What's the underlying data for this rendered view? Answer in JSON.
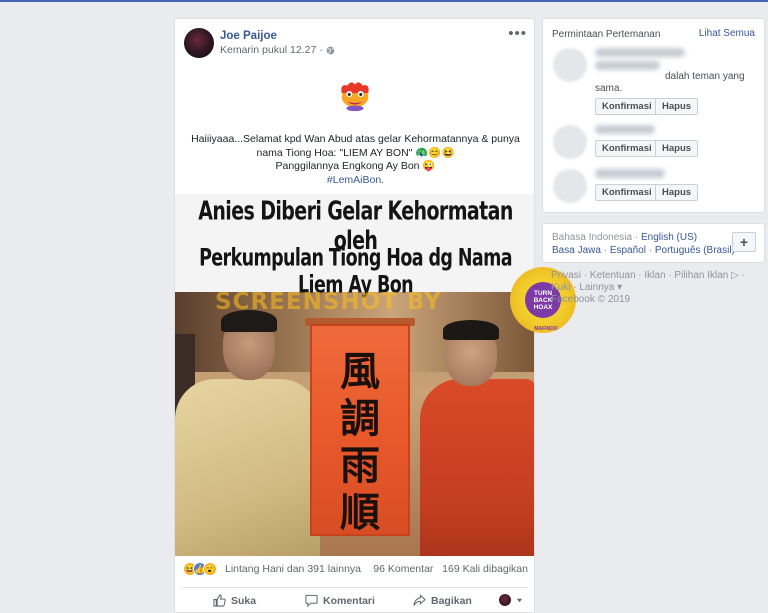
{
  "post": {
    "author": "Joe Paijoe",
    "timestamp": "Kemarin pukul 12.27",
    "privacy_separator": "·",
    "privacy_icon": "globe-icon",
    "more_label": "•••",
    "text_line1": "Haiiiyaaa...Selamat kpd Wan Abud atas gelar Kehormatannya & punya",
    "text_line2": "nama Tiong Hoa: \"LIEM AY BON\" 🦚😊😆",
    "text_line3": "Panggilannya Engkong Ay Bon 😜",
    "hashtag": "#LemAiBon.",
    "image": {
      "headline1": "Anies Diberi Gelar  Kehormatan oleh",
      "headline2": "Perkumpulan Tiong Hoa dg Nama Liem Ay Bon",
      "watermark": "SCREENSHOT BY",
      "scroll_chars": [
        "風",
        "調",
        "雨",
        "順"
      ],
      "seal_text": [
        "TURN",
        "BACK",
        "HOAX"
      ],
      "seal_ring": "MAFINDO"
    },
    "reactions_text": "Lintang Hani dan 391 lainnya",
    "comments_count": "96 Komentar",
    "shares_count": "169 Kali dibagikan",
    "actions": {
      "like": "Suka",
      "comment": "Komentari",
      "share": "Bagikan"
    }
  },
  "friend_requests": {
    "title": "Permintaan Pertemanan",
    "see_all": "Lihat Semua",
    "mutual_text_a": "dalah teman yang",
    "mutual_text_b": "sama.",
    "confirm_label": "Konfirmasi",
    "delete_label": "Hapus"
  },
  "languages": {
    "current": "Bahasa Indonesia",
    "sep": " · ",
    "english": "English (US)",
    "jawa": "Basa Jawa",
    "espanol": "Español",
    "portugues": "Português (Brasil)",
    "add_label": "+"
  },
  "footer": {
    "privacy": "Privasi",
    "terms": "Ketentuan",
    "ads": "Iklan",
    "ad_choices": "Pilihan Iklan",
    "cookies": "Kuki",
    "more": "Lainnya",
    "copyright": "Facebook © 2019"
  },
  "colors": {
    "brand": "#4267b2",
    "link": "#385898",
    "background": "#e9ebee"
  }
}
